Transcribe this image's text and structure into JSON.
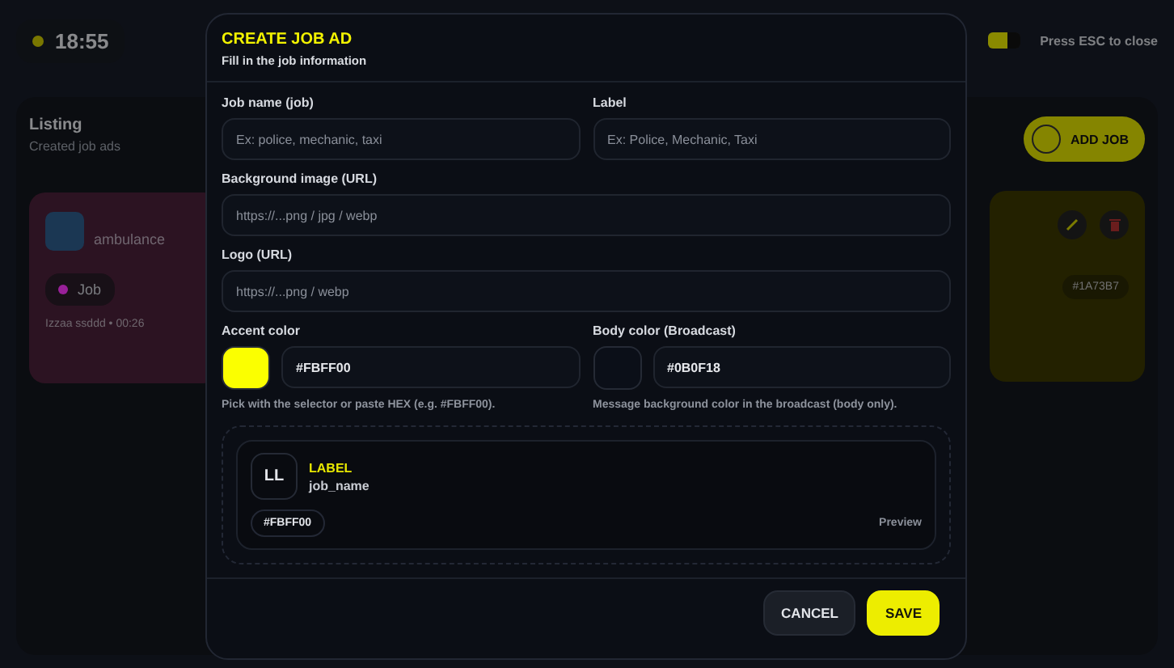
{
  "top_bar": {
    "clock": "18:55",
    "toggle": {
      "on": true
    },
    "hint": "Press ESC to close"
  },
  "listing": {
    "title": "Listing",
    "subtitle": "Created job ads",
    "add_button": "ADD JOB"
  },
  "job_cards": [
    {
      "kind": "photo",
      "name": "ambulance",
      "tag": "Job",
      "color": "#a0209a",
      "meta": "Izzaa ssddd • 00:26"
    },
    {
      "kind": "accent",
      "hex": "#1A73B7"
    }
  ],
  "modal": {
    "title": "CREATE JOB AD",
    "subtitle": "Fill in the job information",
    "rows": [
      [
        {
          "kind": "text",
          "label": "Job name (job)",
          "placeholder": "Ex: police, mechanic, taxi"
        },
        {
          "kind": "text",
          "label": "Label",
          "placeholder": "Ex: Police, Mechanic, Taxi"
        }
      ],
      [
        {
          "kind": "text",
          "label": "Background image (URL)",
          "placeholder": "https://...png / jpg / webp"
        }
      ],
      [
        {
          "kind": "text",
          "label": "Logo (URL)",
          "placeholder": "https://...png / webp"
        }
      ],
      [
        {
          "kind": "color",
          "label": "Accent color",
          "value": "#FBFF00",
          "color": "#fbff00",
          "hint": "Pick with the selector or paste HEX (e.g. #FBFF00)."
        },
        {
          "kind": "color",
          "label": "Body color (Broadcast)",
          "value": "#0B0F18",
          "color": "#0b0f18",
          "hint": "Message background color in the broadcast (body only)."
        }
      ]
    ],
    "preview": {
      "initials": "LL",
      "label": "LABEL",
      "name": "job_name",
      "hex": "#FBFF00",
      "caption": "Preview"
    },
    "buttons": [
      {
        "kind": "secondary",
        "label": "CANCEL"
      },
      {
        "kind": "primary",
        "label": "SAVE"
      }
    ]
  }
}
